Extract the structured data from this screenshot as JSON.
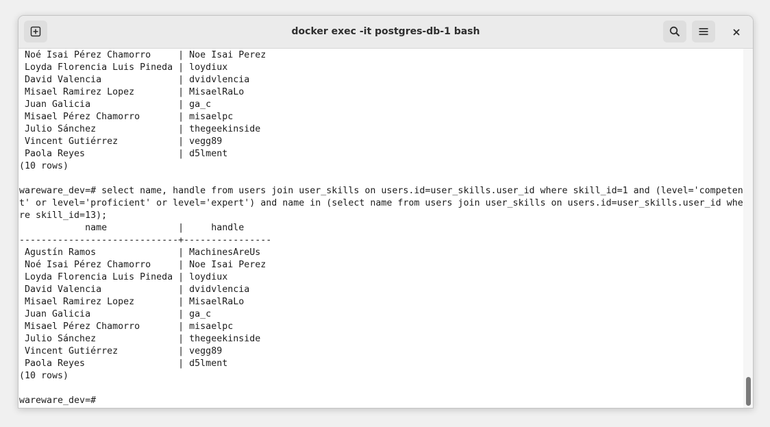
{
  "window": {
    "title": "docker exec -it postgres-db-1 bash"
  },
  "titlebar": {
    "new_tab_icon": "new-tab-plus-icon",
    "search_icon": "search-icon",
    "menu_icon": "hamburger-menu-icon",
    "close_icon": "close-icon"
  },
  "terminal": {
    "lines": [
      " Noé Isai Pérez Chamorro     | Noe Isai Perez",
      " Loyda Florencia Luis Pineda | loydiux",
      " David Valencia              | dvidvlencia",
      " Misael Ramirez Lopez        | MisaelRaLo",
      " Juan Galicia                | ga_c",
      " Misael Pérez Chamorro       | misaelpc",
      " Julio Sánchez               | thegeekinside",
      " Vincent Gutiérrez           | vegg89",
      " Paola Reyes                 | d5lment",
      "(10 rows)",
      "",
      "wareware_dev=# select name, handle from users join user_skills on users.id=user_skills.user_id where skill_id=1 and (level='competen",
      "t' or level='proficient' or level='expert') and name in (select name from users join user_skills on users.id=user_skills.user_id whe",
      "re skill_id=13);",
      "            name             |     handle",
      "-----------------------------+----------------",
      " Agustín Ramos               | MachinesAreUs",
      " Noé Isai Pérez Chamorro     | Noe Isai Perez",
      " Loyda Florencia Luis Pineda | loydiux",
      " David Valencia              | dvidvlencia",
      " Misael Ramirez Lopez        | MisaelRaLo",
      " Juan Galicia                | ga_c",
      " Misael Pérez Chamorro       | misaelpc",
      " Julio Sánchez               | thegeekinside",
      " Vincent Gutiérrez           | vegg89",
      " Paola Reyes                 | d5lment",
      "(10 rows)",
      "",
      "wareware_dev=# "
    ]
  },
  "scrollbar": {
    "position_fraction": 0.96
  },
  "colors": {
    "titlebar": "#ebebeb",
    "terminal_bg": "#ffffff",
    "terminal_fg": "#1c1c1c",
    "scroll_thumb": "#7a7a7a"
  }
}
